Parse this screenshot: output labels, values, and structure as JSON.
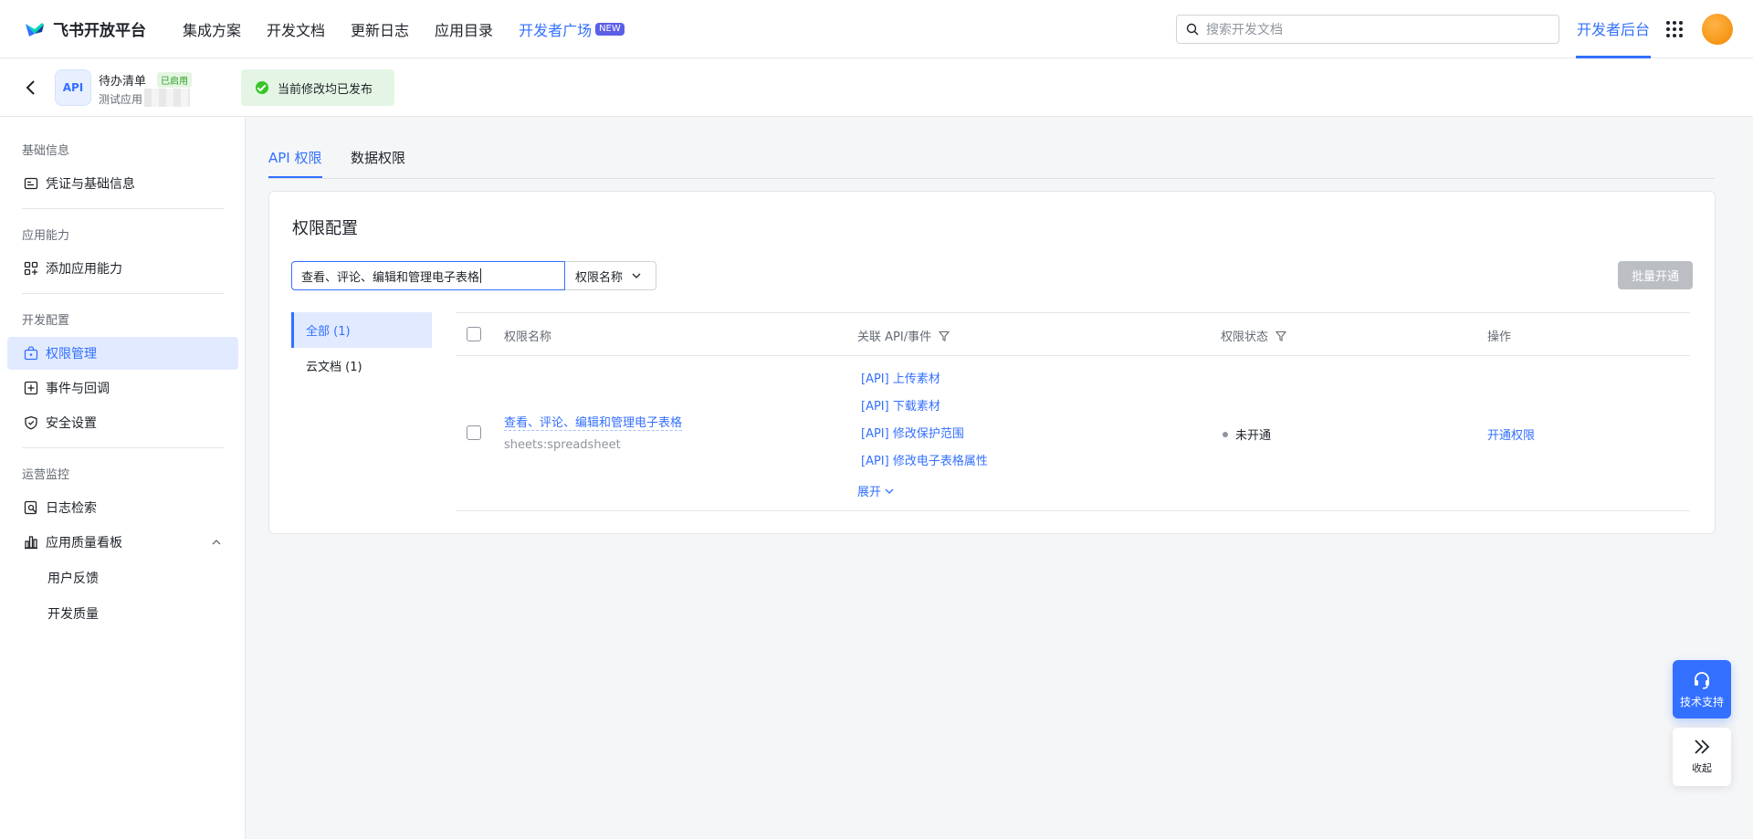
{
  "brand": {
    "name": "飞书开放平台"
  },
  "nav": {
    "items": [
      "集成方案",
      "开发文档",
      "更新日志",
      "应用目录"
    ],
    "plaza": {
      "label": "开发者广场",
      "badge": "NEW"
    },
    "search_placeholder": "搜索开发文档",
    "console": "开发者后台"
  },
  "app": {
    "icon_text": "API",
    "name": "待办清单",
    "status_badge": "已启用",
    "sub": "测试应用",
    "publish_status": "当前修改均已发布"
  },
  "sidebar": {
    "groups": [
      {
        "title": "基础信息",
        "items": [
          {
            "label": "凭证与基础信息",
            "icon": "credential-icon"
          }
        ]
      },
      {
        "title": "应用能力",
        "items": [
          {
            "label": "添加应用能力",
            "icon": "add-capability-icon"
          }
        ]
      },
      {
        "title": "开发配置",
        "items": [
          {
            "label": "权限管理",
            "icon": "permission-icon",
            "active": true
          },
          {
            "label": "事件与回调",
            "icon": "event-icon"
          },
          {
            "label": "安全设置",
            "icon": "shield-icon"
          }
        ]
      },
      {
        "title": "运营监控",
        "items": [
          {
            "label": "日志检索",
            "icon": "log-search-icon"
          },
          {
            "label": "应用质量看板",
            "icon": "chart-icon",
            "expanded": true,
            "children": [
              "用户反馈",
              "开发质量"
            ]
          }
        ]
      }
    ]
  },
  "tabs": [
    {
      "label": "API 权限",
      "active": true
    },
    {
      "label": "数据权限"
    }
  ],
  "card": {
    "title": "权限配置",
    "filter_value": "查看、评论、编辑和管理电子表格",
    "filter_field": "权限名称",
    "batch_button": "批量开通",
    "categories": [
      {
        "label": "全部 (1)",
        "active": true
      },
      {
        "label": "云文档 (1)"
      }
    ],
    "columns": {
      "name": "权限名称",
      "api": "关联 API/事件",
      "status": "权限状态",
      "action": "操作"
    },
    "rows": [
      {
        "name": "查看、评论、编辑和管理电子表格",
        "code": "sheets:spreadsheet",
        "apis": [
          "[API] 上传素材",
          "[API] 下载素材",
          "[API] 修改保护范围",
          "[API] 修改电子表格属性"
        ],
        "expand": "展开",
        "status": "未开通",
        "action": "开通权限"
      }
    ]
  },
  "float": {
    "support": "技术支持",
    "collapse": "收起"
  },
  "colors": {
    "accent": "#3370ff",
    "active_bg": "#e1eaff",
    "success_bg": "#e4f5e6"
  }
}
